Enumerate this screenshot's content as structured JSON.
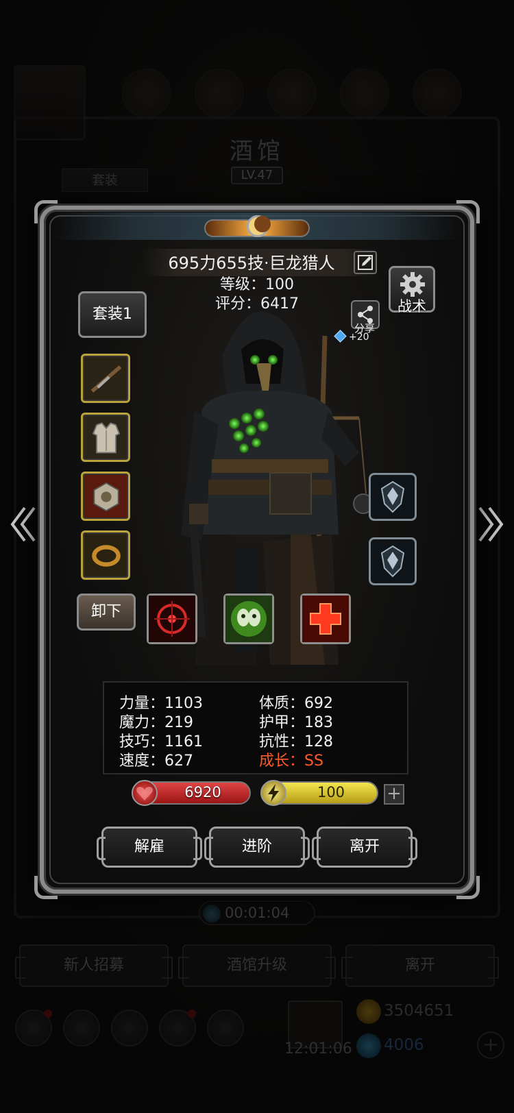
{
  "background": {
    "title": "酒馆",
    "level": "LV.47",
    "tab_suit": "套装",
    "timer": "00:01:04",
    "buttons": {
      "recruit": "新人招募",
      "upgrade": "酒馆升级",
      "leave": "离开"
    },
    "clock": "12:01:06",
    "gold": "3504651",
    "gems": "4006",
    "plus": "+"
  },
  "hero": {
    "name": "695力655技·巨龙猎人",
    "level": "等级：100",
    "score": "评分：6417",
    "suit_button": "套装1",
    "unequip_button": "卸下",
    "tactics_label": "战术",
    "share_label": "分享",
    "share_reward": "+20",
    "equipment": [
      "rifle",
      "chest-armor",
      "amulet",
      "ring"
    ],
    "runes": [
      "rune-shield",
      "rune-shield"
    ],
    "skills": [
      "crosshair-skill",
      "poison-skill",
      "heal-skill"
    ]
  },
  "stats": {
    "strength": "力量：1103",
    "magic": "魔力：219",
    "skill": "技巧：1161",
    "speed": "速度：627",
    "constitution": "体质：692",
    "armor": "护甲：183",
    "resistance": "抗性：128",
    "growth": "成长：SS"
  },
  "bars": {
    "hp": "6920",
    "mp": "100",
    "add": "+"
  },
  "actions": {
    "dismiss": "解雇",
    "advance": "进阶",
    "leave": "离开"
  },
  "colors": {
    "growth": "#ff5a2a",
    "slot_gold": "#bba23a",
    "accent_orange": "#e39a3a"
  }
}
